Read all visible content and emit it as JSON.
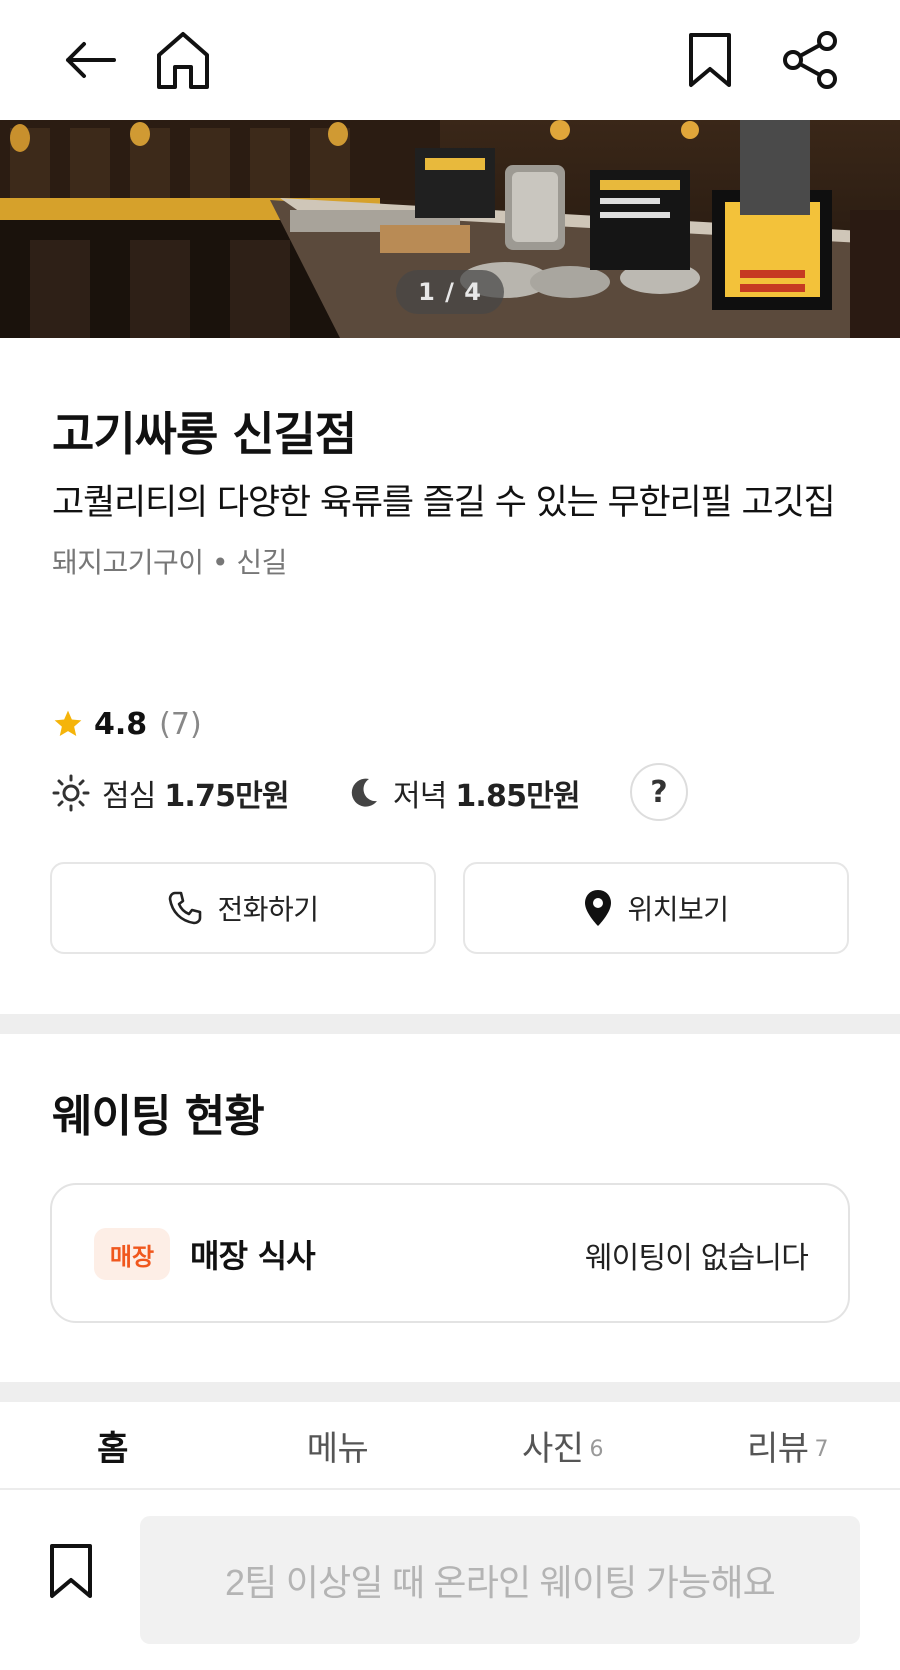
{
  "hero": {
    "counter": "1 / 4"
  },
  "restaurant": {
    "name": "고기싸롱 신길점",
    "description": "고퀄리티의 다양한 육류를 즐길 수 있는 무한리필 고깃집",
    "category": "돼지고기구이 • 신길"
  },
  "rating": {
    "icon": "star-icon",
    "score": "4.8",
    "count": "(7)"
  },
  "prices": {
    "lunch_label": "점심",
    "lunch_value": "1.75만원",
    "dinner_label": "저녁",
    "dinner_value": "1.85만원",
    "help_label": "?"
  },
  "actions": {
    "call_label": "전화하기",
    "location_label": "위치보기"
  },
  "waiting": {
    "title": "웨이팅 현황",
    "badge": "매장",
    "type": "매장 식사",
    "status": "웨이팅이 없습니다"
  },
  "tabs": [
    {
      "label": "홈",
      "count": ""
    },
    {
      "label": "메뉴",
      "count": ""
    },
    {
      "label": "사진",
      "count": "6"
    },
    {
      "label": "리뷰",
      "count": "7"
    }
  ],
  "bottom": {
    "cta_label": "2팀 이상일 때 온라인 웨이팅 가능해요"
  },
  "colors": {
    "accent": "#f0571d",
    "badge_bg": "#fdeee6",
    "star": "#f5b40a",
    "divider": "#eeeeee"
  }
}
